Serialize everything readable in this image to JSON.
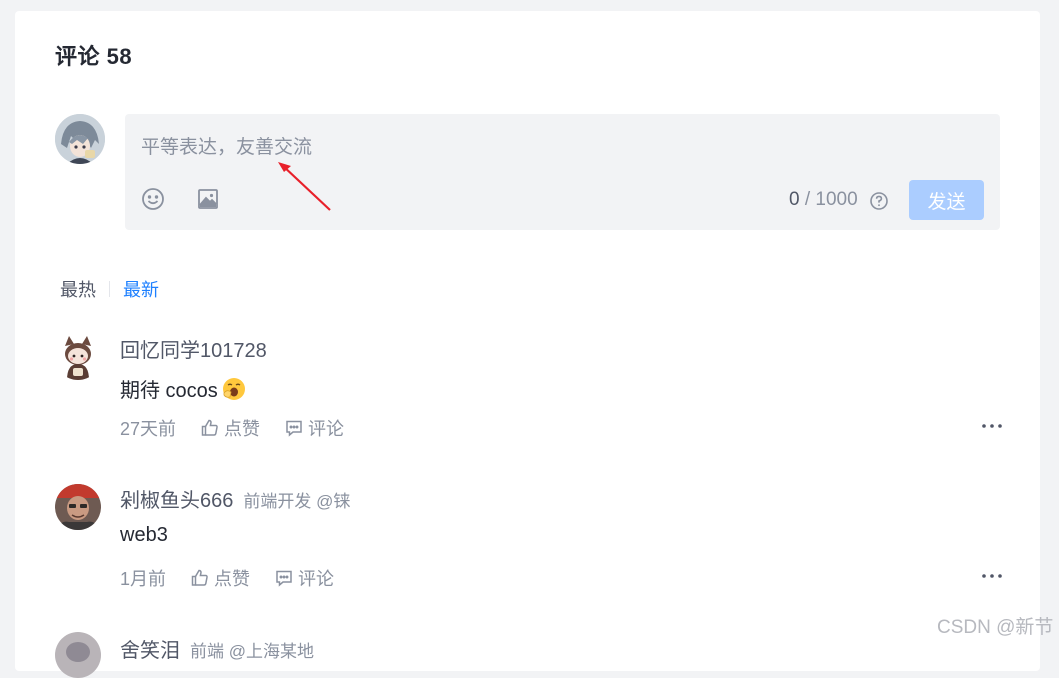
{
  "header": {
    "title": "评论 58"
  },
  "editor": {
    "placeholder": "平等表达，友善交流",
    "count_current": "0",
    "count_max": "/ 1000",
    "send_label": "发送",
    "icons": [
      "emoji-icon",
      "image-icon",
      "help-icon"
    ]
  },
  "sort": {
    "hot_label": "最热",
    "new_label": "最新"
  },
  "comments": [
    {
      "name": "回忆同学101728",
      "meta": "",
      "text": "期待 cocos",
      "time": "27天前",
      "like_label": "点赞",
      "comment_label": "评论"
    },
    {
      "name": "剁椒鱼头666",
      "meta": "前端开发 @铼",
      "text": "web3",
      "time": "1月前",
      "like_label": "点赞",
      "comment_label": "评论"
    },
    {
      "name": "舍笑泪",
      "meta": "前端 @上海某地"
    }
  ],
  "watermark": "CSDN @新节",
  "colors": {
    "accent": "#1e80ff",
    "send_disabled": "#abcdff",
    "editor_bg": "#f2f3f5",
    "arrow": "#e8202a"
  }
}
